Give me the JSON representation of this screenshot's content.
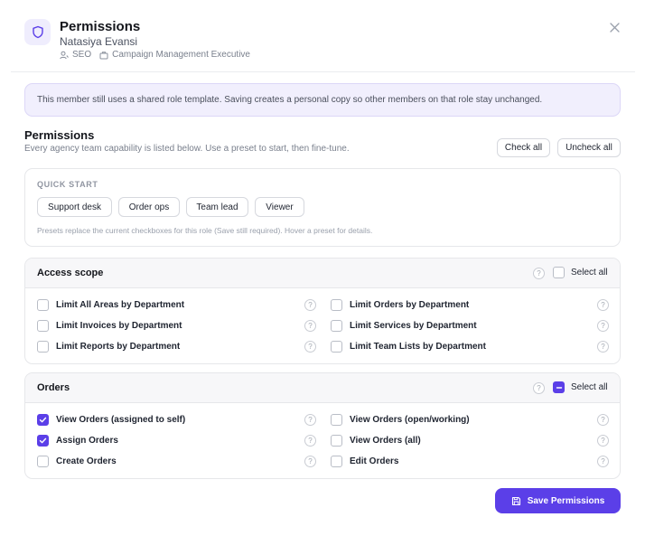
{
  "header": {
    "title": "Permissions",
    "member_name": "Natasiya Evansi",
    "department": "SEO",
    "role": "Campaign Management Executive"
  },
  "banner": {
    "text": "This member still uses a shared role template. Saving creates a personal copy so other members on that role stay unchanged."
  },
  "permissions": {
    "title": "Permissions",
    "description": "Every agency team capability is listed below. Use a preset to start, then fine-tune.",
    "check_all_label": "Check all",
    "uncheck_all_label": "Uncheck all"
  },
  "quick_start": {
    "label": "QUICK START",
    "presets": [
      "Support desk",
      "Order ops",
      "Team lead",
      "Viewer"
    ],
    "note": "Presets replace the current checkboxes for this role (Save still required). Hover a preset for details."
  },
  "groups": [
    {
      "title": "Access scope",
      "select_all_label": "Select all",
      "select_all_state": "unchecked",
      "items": [
        {
          "label": "Limit All Areas by Department",
          "checked": false
        },
        {
          "label": "Limit Orders by Department",
          "checked": false
        },
        {
          "label": "Limit Invoices by Department",
          "checked": false
        },
        {
          "label": "Limit Services by Department",
          "checked": false
        },
        {
          "label": "Limit Reports by Department",
          "checked": false
        },
        {
          "label": "Limit Team Lists by Department",
          "checked": false
        }
      ]
    },
    {
      "title": "Orders",
      "select_all_label": "Select all",
      "select_all_state": "partial",
      "items": [
        {
          "label": "View Orders (assigned to self)",
          "checked": true
        },
        {
          "label": "View Orders (open/working)",
          "checked": false
        },
        {
          "label": "Assign Orders",
          "checked": true
        },
        {
          "label": "View Orders (all)",
          "checked": false
        },
        {
          "label": "Create Orders",
          "checked": false
        },
        {
          "label": "Edit Orders",
          "checked": false
        }
      ]
    }
  ],
  "help_symbol": "?",
  "save_label": "Save Permissions",
  "colors": {
    "accent": "#5b3fe8",
    "banner_bg": "#f1effd"
  }
}
